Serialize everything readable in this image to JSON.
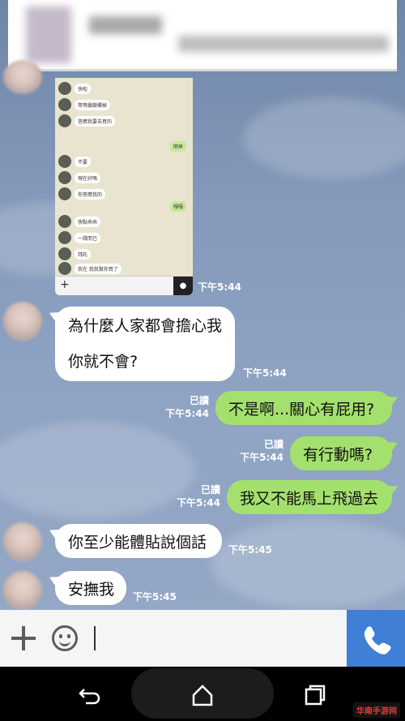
{
  "chat": {
    "messages": [
      {
        "from": "them",
        "lines": [
          "為什麼人家都會擔心我",
          "你就不會?"
        ],
        "time": "下午5:44"
      },
      {
        "from": "me",
        "text": "不是啊...關心有屁用?",
        "read": "已讀",
        "time": "下午5:44"
      },
      {
        "from": "me",
        "text": "有行動嗎?",
        "read": "已讀",
        "time": "下午5:44"
      },
      {
        "from": "me",
        "text": "我又不能馬上飛過去",
        "read": "已讀",
        "time": "下午5:44"
      },
      {
        "from": "them",
        "text": "你至少能體貼說個話",
        "time": "下午5:45"
      },
      {
        "from": "them",
        "text": "安撫我",
        "time": "下午5:45"
      }
    ],
    "image_time": "下午5:44"
  },
  "embedded_screenshot": {
    "left_messages": [
      "快啦",
      "等等嚴鎖欄掉",
      "答應我要去買的",
      "不要",
      "現在好嗎",
      "你答應我的",
      "快點乖乖",
      "一錢而已",
      "拜託",
      "我在 我就幫你買了"
    ],
    "right_messages": [
      "明早",
      "嘎嘎"
    ]
  },
  "input": {
    "placeholder": ""
  },
  "icons": {
    "plus": "plus-icon",
    "emoji": "emoji-icon",
    "call": "phone-icon",
    "back": "back-icon",
    "home": "home-icon",
    "recents": "recents-icon"
  },
  "colors": {
    "outgoing_bubble": "#a4e06e",
    "incoming_bubble": "#ffffff",
    "call_button": "#3f7fd6"
  },
  "watermark": "华南手游网"
}
